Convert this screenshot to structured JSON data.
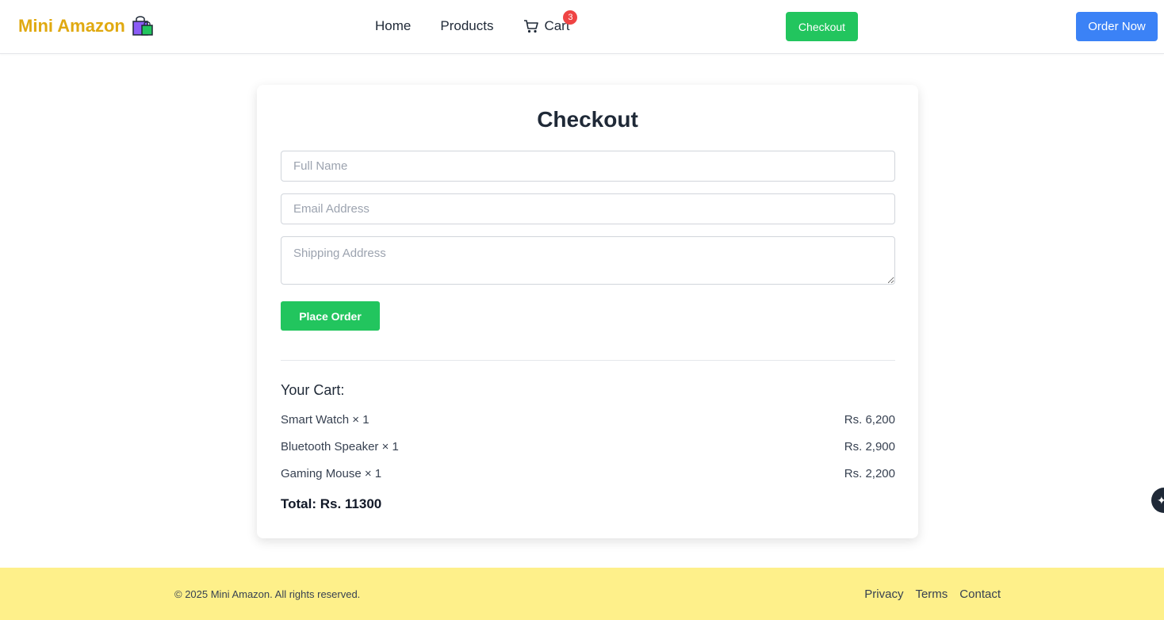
{
  "header": {
    "brand": "Mini Amazon",
    "brand_icon": "shopping-bags-icon",
    "nav": {
      "home": "Home",
      "products": "Products",
      "cart": "Cart",
      "cart_count": "3"
    },
    "checkout_button": "Checkout",
    "order_now_button": "Order Now"
  },
  "checkout": {
    "title": "Checkout",
    "full_name_placeholder": "Full Name",
    "email_placeholder": "Email Address",
    "shipping_placeholder": "Shipping Address",
    "place_order_button": "Place Order",
    "cart_title": "Your Cart:",
    "items": [
      {
        "name": "Smart Watch × 1",
        "price": "Rs. 6,200"
      },
      {
        "name": "Bluetooth Speaker × 1",
        "price": "Rs. 2,900"
      },
      {
        "name": "Gaming Mouse × 1",
        "price": "Rs. 2,200"
      }
    ],
    "total": "Total: Rs. 11300"
  },
  "footer": {
    "copyright": "© 2025 Mini Amazon. All rights reserved.",
    "links": [
      "Privacy",
      "Terms",
      "Contact"
    ]
  },
  "colors": {
    "brand": "#e0a910",
    "green": "#22c55e",
    "blue": "#3b82f6",
    "badge": "#ef4444",
    "footer_bg": "#fef08a"
  }
}
